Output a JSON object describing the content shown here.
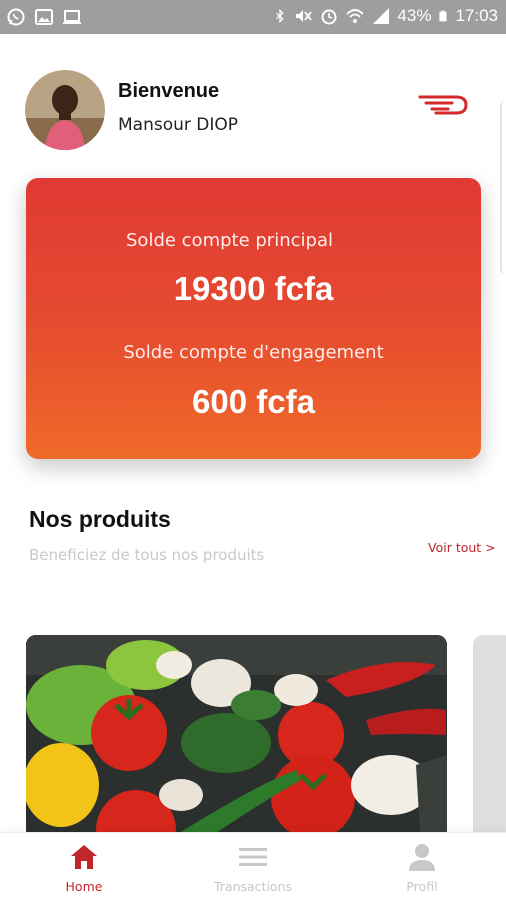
{
  "status_bar": {
    "left_icons": [
      "whatsapp-icon",
      "gallery-icon",
      "laptop-icon"
    ],
    "right_icons": [
      "bluetooth-icon",
      "mute-icon",
      "alarm-icon",
      "wifi-icon",
      "signal-icon"
    ],
    "battery": "43%",
    "time": "17:03"
  },
  "header": {
    "greeting": "Bienvenue",
    "user_name": "Mansour DIOP",
    "logo_icon": "brand-logo-icon"
  },
  "balance_card": {
    "main_label": "Solde compte principal",
    "main_amount": "19300 fcfa",
    "engagement_label": "Solde compte d'engagement",
    "engagement_amount": "600 fcfa"
  },
  "products": {
    "title": "Nos produits",
    "subtitle": "Beneficiez de tous nos produits",
    "see_all": "Voir tout >"
  },
  "bottom_nav": {
    "items": [
      {
        "label": "Home",
        "icon": "home-icon",
        "active": true
      },
      {
        "label": "Transactions",
        "icon": "menu-icon",
        "active": false
      },
      {
        "label": "Profil",
        "icon": "user-icon",
        "active": false
      }
    ]
  },
  "colors": {
    "accent": "#c0262a",
    "card_top": "#e03a34",
    "card_bottom": "#ef6a2a",
    "status_bar": "#9e9e9e"
  }
}
